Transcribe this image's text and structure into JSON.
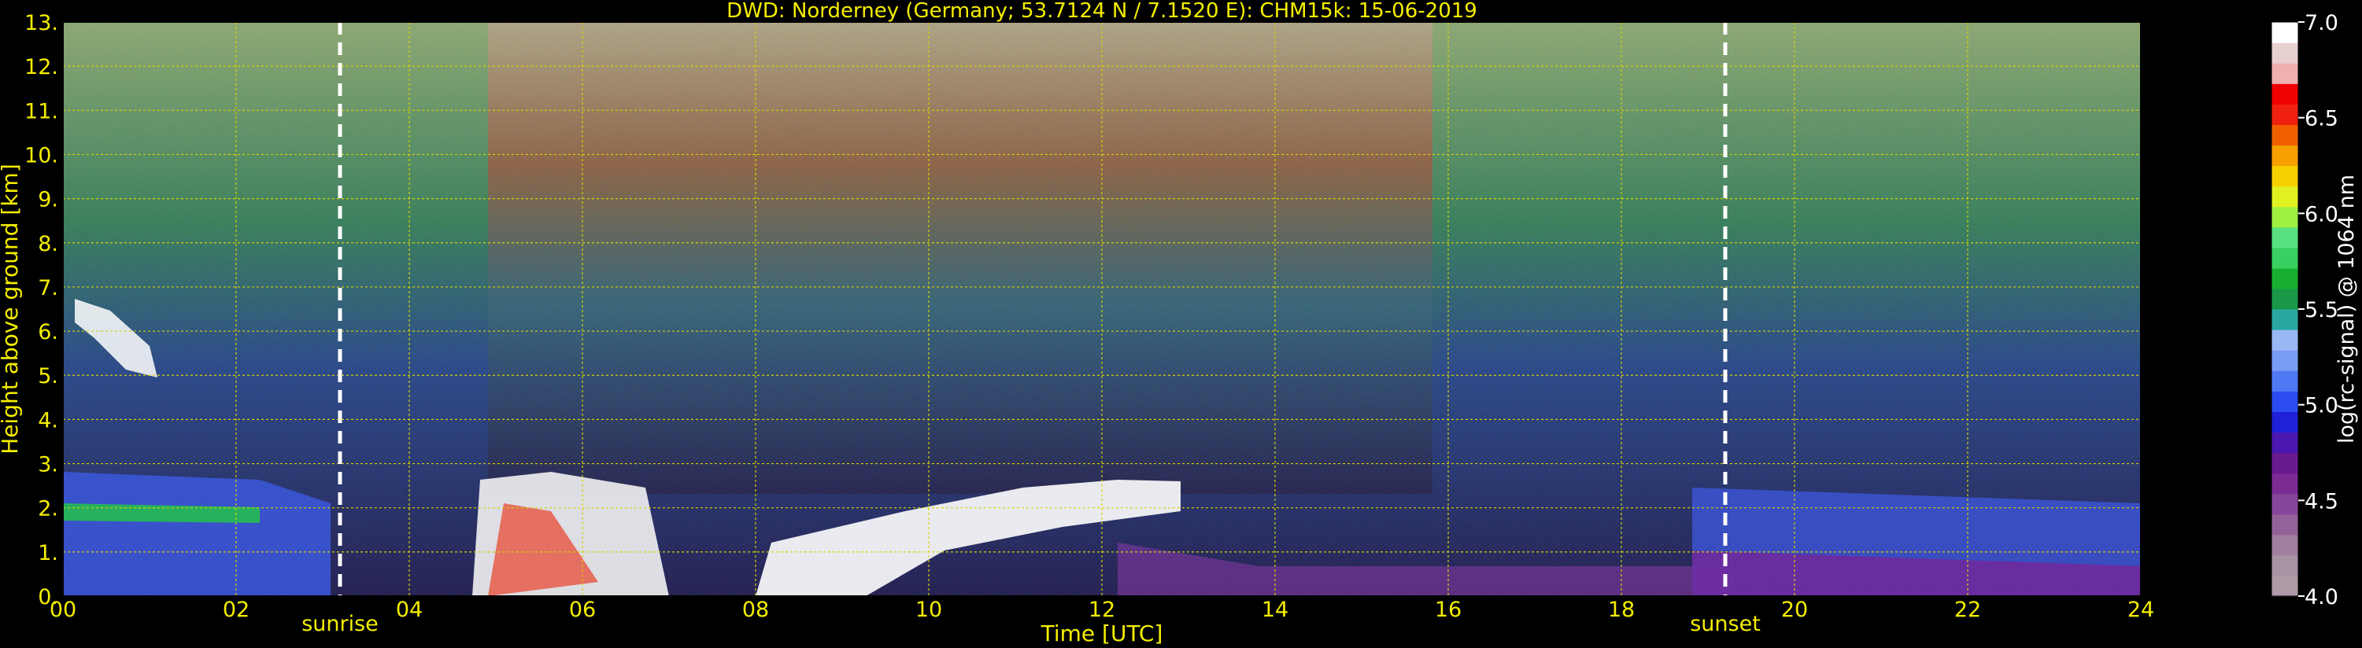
{
  "chart_data": {
    "type": "heatmap",
    "title": "DWD: Norderney (Germany; 53.7124 N / 7.1520 E):    CHM15k: 15-06-2019",
    "xlabel": "Time [UTC]",
    "ylabel": "Height above ground [km]",
    "xlim": [
      0,
      24
    ],
    "ylim": [
      0,
      13
    ],
    "x_ticks": [
      "00",
      "02",
      "04",
      "06",
      "08",
      "10",
      "12",
      "14",
      "16",
      "18",
      "20",
      "22",
      "24"
    ],
    "y_ticks": [
      "0.",
      "1.",
      "2.",
      "3.",
      "4.",
      "5.",
      "6.",
      "7.",
      "8.",
      "9.",
      "10.",
      "11.",
      "12.",
      "13."
    ],
    "grid": true,
    "markers": [
      {
        "label": "sunrise",
        "time": 3.2
      },
      {
        "label": "sunset",
        "time": 19.2
      }
    ],
    "colorbar": {
      "label": "log(rc-signal) @ 1064 nm",
      "range": [
        4.0,
        7.0
      ],
      "ticks": [
        "4.0",
        "4.5",
        "5.0",
        "5.5",
        "6.0",
        "6.5",
        "7.0"
      ]
    }
  },
  "colors": {
    "background": "#000000",
    "text": "#f4ee00",
    "grid": "#d6d300",
    "marker": "#ffffff",
    "colorbar_text": "#ffffff"
  }
}
